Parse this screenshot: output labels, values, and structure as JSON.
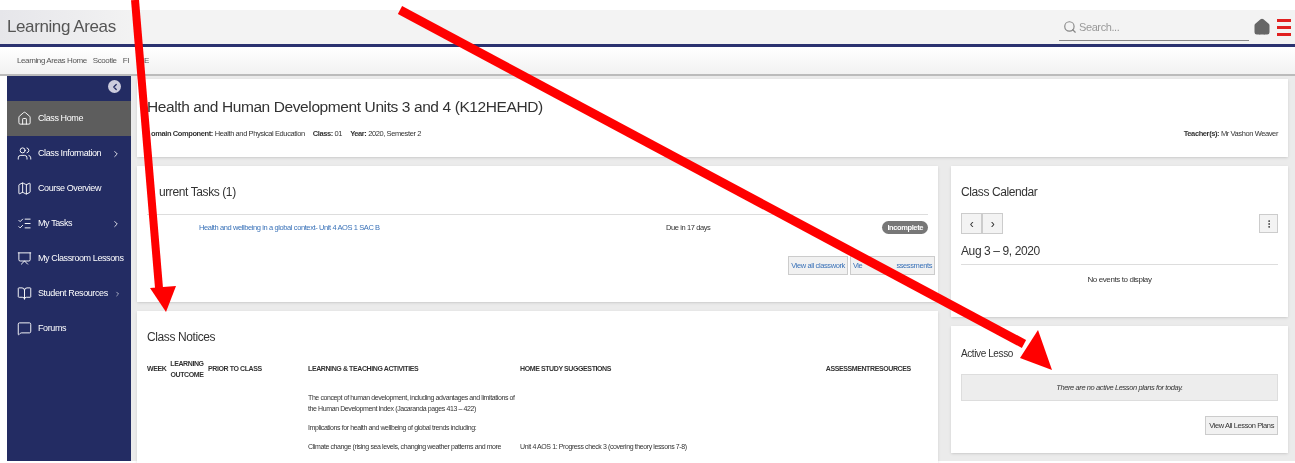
{
  "header": {
    "logo": "Learning Areas",
    "search": {
      "placeholder": "Search..."
    }
  },
  "breadcrumbs": [
    {
      "parts": [
        "Learning Areas Home"
      ]
    },
    {
      "parts": [
        "Scootle"
      ]
    },
    {
      "parts": [
        "FI",
        "E"
      ]
    }
  ],
  "sidebar": {
    "items": [
      {
        "label": "Class Home",
        "selected": true,
        "expandable": false
      },
      {
        "label": "Class Information",
        "selected": false,
        "expandable": true
      },
      {
        "label": "Course Overview",
        "selected": false,
        "expandable": false
      },
      {
        "label": "My Tasks",
        "selected": false,
        "expandable": true
      },
      {
        "label": "My Classroom Lessons",
        "selected": false,
        "expandable": false
      },
      {
        "label": "Student Resources",
        "selected": false,
        "expandable": true
      },
      {
        "label": "Forums",
        "selected": false,
        "expandable": false
      }
    ]
  },
  "course": {
    "title": "Health and Human Development Units 3 and 4 (K12HEAHD)",
    "meta": [
      {
        "label": "omain Component:",
        "value": "Health and Physical Education"
      },
      {
        "label": "Class:",
        "value": "01"
      },
      {
        "label": "Year:",
        "value": "2020, Semester 2"
      }
    ],
    "teacher": {
      "label": "Teacher(s):",
      "value": "Mr Vashon Weaver"
    }
  },
  "current_tasks": {
    "title": "urrent Tasks (1)",
    "tasks": [
      {
        "title": "Health and wellbeing in a global context- Unit 4 AOS 1 SAC B",
        "due": "Due in 17 days",
        "status": "Incomplete"
      }
    ],
    "buttons": [
      {
        "parts": [
          "View all classwork"
        ]
      },
      {
        "parts": [
          "Vie",
          "ssessments"
        ]
      }
    ]
  },
  "class_notices": {
    "title": "Class Notices",
    "columns": [
      "WEEK",
      "LEARNING OUTCOME",
      "PRIOR TO CLASS",
      "LEARNING & TEACHING ACTIVITIES",
      "HOME STUDY SUGGESTIONS",
      "ASSESSMENT",
      "RESOURCES"
    ],
    "rows": [
      {
        "activities": "The concept of human development, including advantages and limitations of the Human Development Index (Jacaranda pages 413 – 422)"
      },
      {
        "activities": "Implications for health and wellbeing of global trends including:"
      },
      {
        "activities": "Climate change (rising sea levels, changing weather patterns and more",
        "home_study": "Unit 4 AOS 1: Progress check 3 (covering theory lessons 7-8)"
      }
    ]
  },
  "calendar": {
    "title": "Class Calendar",
    "prev": "‹",
    "next": "›",
    "range": "Aug 3 – 9, 2020",
    "empty": "No events to display"
  },
  "active_lessons": {
    "title": "Active Lesso",
    "empty": "There are no active Lesson plans for today.",
    "button": "View All Lesson Plans"
  }
}
